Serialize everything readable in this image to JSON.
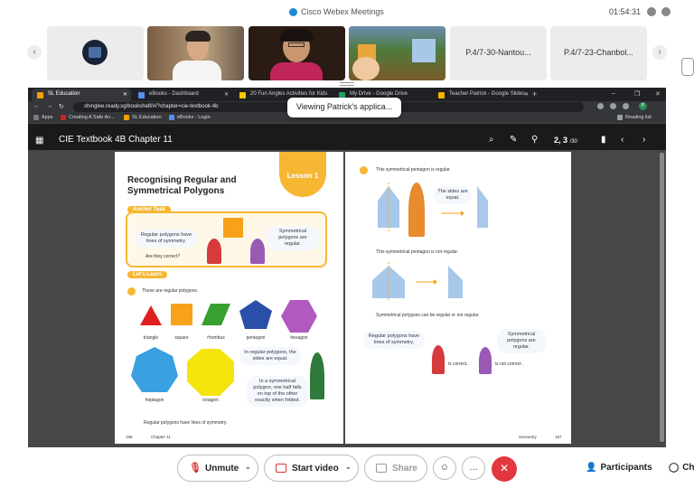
{
  "webex": {
    "app_title": "Cisco Webex Meetings",
    "time": "01:54:31"
  },
  "participants": [
    {
      "label": "",
      "kind": "video-logo"
    },
    {
      "label": "",
      "kind": "video-man"
    },
    {
      "label": "",
      "kind": "video-woman"
    },
    {
      "label": "",
      "kind": "video-game"
    },
    {
      "label": "P.4/7-30-Nantou..."
    },
    {
      "label": "P.4/7-23-Chanbol..."
    }
  ],
  "sharing_banner": "Viewing Patrick's applica...",
  "browser": {
    "tabs": [
      {
        "label": "SL Education",
        "color": "#f4a000",
        "active": true
      },
      {
        "label": "eBooks - Dashboard",
        "color": "#5b8def",
        "active": false
      },
      {
        "label": "20 Fun Angles Activities for Kids",
        "color": "#f7c900",
        "active": false
      },
      {
        "label": "My Drive - Google Drive",
        "color": "#1fa463",
        "active": false
      },
      {
        "label": "Teacher Patrick - Google Slides",
        "color": "#f4b400",
        "active": false
      }
    ],
    "url": "shinglee.ready.sg/bookshelf/#/?chapter=cie-textbook-4b",
    "bookmarks": [
      {
        "label": "Apps",
        "color": "#7a7a7a"
      },
      {
        "label": "Creating A Safe An...",
        "color": "#c62828"
      },
      {
        "label": "SL Education",
        "color": "#f4a000"
      },
      {
        "label": "eBooks - Login",
        "color": "#5b8def"
      }
    ],
    "reading_list": "Reading list",
    "avatar_letter": "P"
  },
  "reader": {
    "title": "CIE Textbook 4B Chapter 11",
    "page_current": "2, 3",
    "page_total": "/30"
  },
  "book": {
    "lesson_label": "Lesson 1",
    "heading": "Recognising Regular and Symmetrical Polygons",
    "anchor_task": "Anchor Task",
    "bubble_boy": "Regular polygons have lines of symmetry.",
    "bubble_girl": "Symmetrical polygons are regular.",
    "are_they_correct": "Are they correct?",
    "lets_learn": "Let's Learn",
    "step1_text": "These are regular polygons.",
    "shapes_row1": [
      "triangle",
      "square",
      "rhombus",
      "pentagon",
      "hexagon"
    ],
    "shapes_row2": [
      "heptagon",
      "octagon"
    ],
    "bubble_sides": "In regular polygons, the sides are equal.",
    "bubble_fold": "In a symmetrical polygon, one half falls on top of the other exactly when folded.",
    "left_footer": "Regular polygons have lines of symmetry.",
    "left_page_no": "156",
    "left_chapter": "Chapter 11",
    "step2_text": "This symmetrical pentagon is regular.",
    "bubble_sides_equal": "The sides are equal.",
    "not_regular_text": "This symmetrical pentagon is not regular.",
    "can_be_text": "Symmetrical polygons can be regular or not regular.",
    "bubble_boy2": "Regular polygons have lines of symmetry.",
    "bubble_girl2": "Symmetrical polygons are regular.",
    "is_correct": "is correct.",
    "is_not_correct": "is not correct.",
    "right_footer": "Geometry",
    "right_page_no": "157"
  },
  "controls": {
    "unmute": "Unmute",
    "start_video": "Start video",
    "share": "Share",
    "participants": "Participants",
    "chat": "Ch"
  }
}
